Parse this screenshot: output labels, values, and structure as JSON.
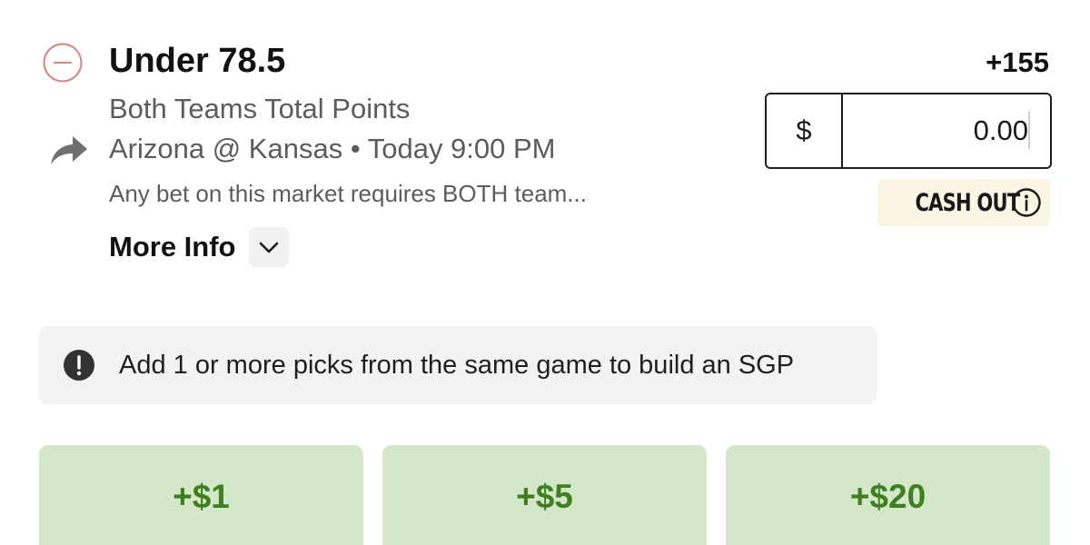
{
  "bet": {
    "selection": "Under 78.5",
    "odds": "+155",
    "market": "Both Teams Total Points",
    "event": "Arizona @ Kansas • Today 9:00 PM",
    "rules": "Any bet on this market requires BOTH team...",
    "more_info_label": "More Info"
  },
  "wager": {
    "currency_symbol": "$",
    "value": "0.00"
  },
  "cash_out": {
    "label": "CASH OUT"
  },
  "sgp_notice": {
    "text": "Add 1 or more picks from the same game to build an SGP"
  },
  "quick_add": [
    {
      "label": "+$1"
    },
    {
      "label": "+$5"
    },
    {
      "label": "+$20"
    }
  ],
  "icons": {
    "remove": "remove-circle-icon",
    "share": "share-arrow-icon",
    "chevron": "chevron-down-icon",
    "info": "info-circle-icon",
    "alert": "exclamation-circle-icon"
  },
  "colors": {
    "remove_icon": "#d88b8b",
    "quick_add_bg": "#d4e7c8",
    "quick_add_text": "#3f7f22",
    "cash_out_bg": "#fbf6e3",
    "notice_bg": "#f3f3f3"
  }
}
